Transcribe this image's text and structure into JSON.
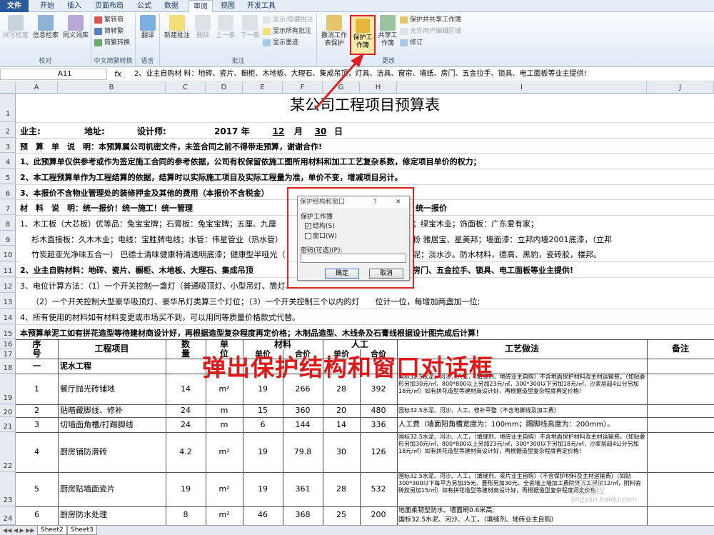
{
  "ribbon_tabs": [
    "文件",
    "开始",
    "插入",
    "页面布局",
    "公式",
    "数据",
    "审阅",
    "视图",
    "开发工具"
  ],
  "ribbon": {
    "groups": {
      "proof": "校对",
      "chinese": "中文简繁转换",
      "language": "语言",
      "comment": "批注",
      "changes": "更改"
    },
    "proof_btns": [
      "拼写检查",
      "信息检索",
      "同义词库"
    ],
    "chinese_btns": [
      "繁转简",
      "简转繁",
      "简繁转换"
    ],
    "translate": "翻译",
    "comment_btns": [
      "新建批注",
      "删除",
      "上一条",
      "下一条"
    ],
    "comment_small": [
      "显示/隐藏批注",
      "显示所有批注",
      "显示墨迹"
    ],
    "unprotect_sheet": "撤消工作表保护",
    "protect_workbook": "保护工作簿",
    "share_workbook": "共享工作簿",
    "changes_small": [
      "保护并共享工作簿",
      "允许用户编辑区域",
      "修订"
    ]
  },
  "formula_bar": {
    "name_box": "A11",
    "fx": "fx",
    "formula": "2、业主自购材 料：地砖、瓷片、橱柜、木地板、大理石、集成吊顶，灯具、洁具、窗帘、墙纸、房门、五金拉手、锁具、电工面板等业主提供!"
  },
  "columns": [
    "A",
    "B",
    "C",
    "D",
    "E",
    "F",
    "G",
    "H",
    "I",
    "J"
  ],
  "rows": [
    "1",
    "2",
    "3",
    "4",
    "5",
    "6",
    "7",
    "8",
    "9",
    "10",
    "11",
    "12",
    "13",
    "14",
    "15",
    "16",
    "17",
    "18",
    "19",
    "20",
    "21",
    "22",
    "23",
    "24"
  ],
  "sheet": {
    "title": "某公司工程项目预算表",
    "r2": {
      "owner": "业主:",
      "addr": "地址:",
      "designer": "设计师:",
      "year": "2017 年",
      "month": "12",
      "m_unit": "月",
      "day": "30",
      "d_unit": "日"
    },
    "r3": "预　算　单　说　明：本预算属公司机密文件，未签合同之前不得带走预算，谢谢合作!",
    "r4": "1、此预算单仅供参考或作为签定施工合同的参考依据，公司有权保留依施工图所用材料和加工工艺复杂系数，修定项目单价的权力；",
    "r5": "2、本工程预算单作为工程结算的依据，结算时以实际施工项目及实际工程量为准，单价不变，增减项目另计。",
    "r6": "3、本报价不含物业管理处的装修押金及其他的费用（本报价不含税金）",
    "r7a": "材　料　说　明：统一报价！统一施工！统一管理",
    "r7b": "统一报价",
    "r8a": "1、木工板（大芯板）优等品：兔宝宝牌；石膏板：兔宝宝牌；五厘、九厘",
    "r8b": "；绿宝木业；饰面板：广东爱有家；",
    "r9a": "杉木直接板：久木木业；电线：宝胜牌电线；水管：伟星管业（热水管）",
    "r9b": "粉   雅居宝、星美邦；墙面漆：立邦内墙2001底漆，（立邦",
    "r10a": "竹炭超亚光净味五合一）   巴德士清味健康特清透明底漆；健康型半哑光（",
    "r10b": "泥；淡水沙。防水材料，德高、黑豹，瓷砖胶，楼邦。",
    "r11a": "2、业主自购材料：地砖、瓷片、橱柜、木地板、大理石、集成吊顶",
    "r11b": "房门、五金拉手、锁具、电工面板等业主提供!",
    "r12a": "3、电位计算方法：（1）一个开关控制一盏灯（普通吸顶灯、小型吊灯、筒灯、日光灯、壁灯、射灯、灯带）计一位；",
    "r13": "（2）一个开关控制大型豪华吸顶灯、豪华吊灯类算三个灯位；（3）一个开关控制三个以内的灯　　位计一位，每增加两盏加一位;",
    "r14": "4、所有使用的材料如有材料变更或市场买不到，可以用同等质量价格款式代替。",
    "r15": "本预算单泥工如有拼花造型等待建材商设计好，再根据造型复杂程度再定价格；木制品造型、木线条及石膏线根据设计图完成后计算！",
    "hdr": {
      "seq": "序",
      "seq2": "号",
      "item": "工程项目",
      "qty": "数",
      "qty2": "量",
      "unit": "单",
      "unit2": "位",
      "mat": "材料",
      "mat_price": "单价",
      "mat_total": "合价",
      "labor": "人工",
      "lab_price": "单价",
      "lab_total": "合价",
      "craft": "工艺做法",
      "note": "备注"
    },
    "section": {
      "seq": "一",
      "name": "泥水工程"
    },
    "items": [
      {
        "seq": "1",
        "name": "餐厅抛光砖铺地",
        "qty": "14",
        "unit": "m²",
        "mp": "19",
        "mt": "266",
        "lp": "28",
        "lt": "392",
        "craft": "国标32.5水泥、河沙、人工，（填缝剂、地砖业主自购）不含地面保护材料及主材运输费。（如贴菱形另加30元/㎡，800*800以上另加23元/㎡，300*300以下另加18元/㎡，沙浆层超4公分另加18元/㎡）如有拼花造型等建材商设计好，再根据造型复杂程度再定价格！"
      },
      {
        "seq": "2",
        "name": "贴暗藏脚线、修补",
        "qty": "24",
        "unit": "m",
        "mp": "15",
        "mt": "360",
        "lp": "20",
        "lt": "480",
        "craft": "国标32.5水泥、河沙、人工、修补平整（不含地脚线及加工费）"
      },
      {
        "seq": "3",
        "name": "切墙面角槽/打踢脚线",
        "qty": "24",
        "unit": "m",
        "mp": "6",
        "mt": "144",
        "lp": "14",
        "lt": "336",
        "craft": "人工费（墙面阳角槽宽度为：100mm；踢脚线高度为：200mm）。"
      },
      {
        "seq": "4",
        "name": "厨房铺防滑砖",
        "qty": "4.2",
        "unit": "m²",
        "mp": "19",
        "mt": "79.8",
        "lp": "30",
        "lt": "126",
        "craft": "国标32.5水泥、河沙、人工，（填缝剂、地砖业主自购）不含地面保护材料及主材运输费。（如贴菱形另加30元/㎡，800*800以上另加23元/㎡，300*300以下另加18元/㎡，沙浆层超4公分另加18元/㎡）如有拼花造型等建材商设计好，再根据造型复杂程度再定价格！"
      },
      {
        "seq": "5",
        "name": "厨房贴墙面瓷片",
        "qty": "19",
        "unit": "m²",
        "mp": "19",
        "mt": "361",
        "lp": "28",
        "lt": "532",
        "craft": "国标32.5水泥、河沙、人工，（填缝剂、瓷片业主自购）（不含保护材料及主材运输费）（如贴300*300以下每平方另加35元、菱形另加30元、全瓷墙上墙加工费除外人工另加12/㎡，附料瓷砖胶另加15/㎡）如有拼花造型等建材商设计好，再根据造型复杂程度再定价格！"
      },
      {
        "seq": "6",
        "name": "厨房防水处理",
        "qty": "8",
        "unit": "m²",
        "mp": "46",
        "mt": "368",
        "lp": "25",
        "lt": "200",
        "craft": "地面柔韧型防水。墙面刷0.6米高;"
      }
    ],
    "r25_craft": "国标32.5水泥、河沙、人工，（填缝剂、地砖业主自购）"
  },
  "dialog": {
    "title": "保护结构和窗口",
    "help": "?",
    "close": "✕",
    "group": "保护工作簿",
    "structure": "结构(S)",
    "window": "窗口(W)",
    "password": "密码(可选)(P):",
    "ok": "确定",
    "cancel": "取消"
  },
  "overlay": "弹出保护结构和窗口对话框",
  "sheet_tabs": [
    "Sheet2",
    "Sheet3"
  ],
  "watermark": "经验",
  "watermark_sub": "jingyan.baidu.com",
  "colors": {
    "accent_red": "#e02020",
    "ribbon_blue": "#2a5a9c"
  }
}
